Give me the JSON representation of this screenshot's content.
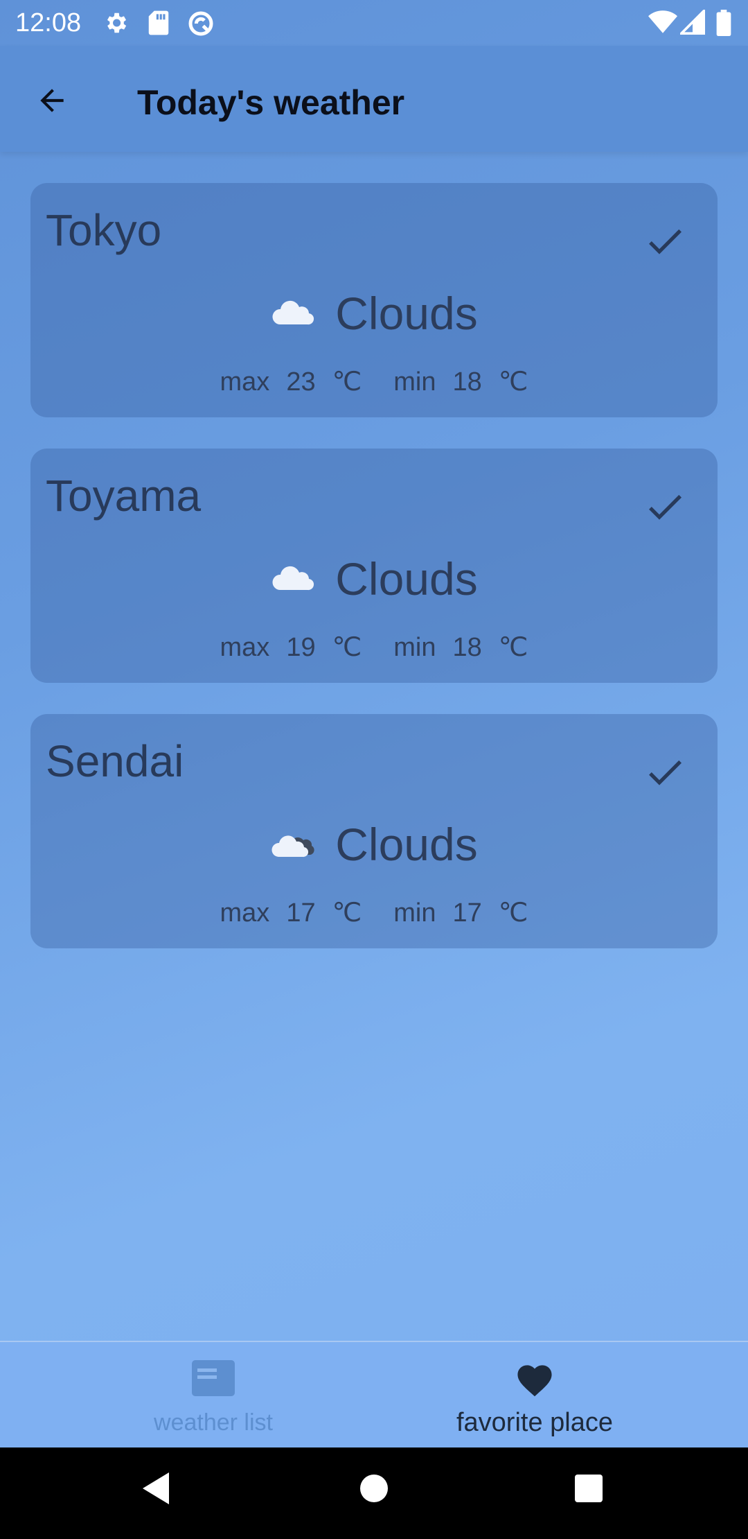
{
  "status_bar": {
    "time": "12:08",
    "icons": [
      "settings-icon",
      "sd-card-icon",
      "sync-icon",
      "wifi-icon",
      "cell-signal-icon",
      "battery-icon"
    ]
  },
  "app_bar": {
    "title": "Today's weather",
    "back_icon": "arrow-back-icon"
  },
  "units": {
    "max": "max",
    "min": "min",
    "deg": "℃"
  },
  "cards": [
    {
      "city": "Tokyo",
      "weather": "Clouds",
      "icon": "cloud-icon",
      "max": "23",
      "min": "18",
      "favorite": true
    },
    {
      "city": "Toyama",
      "weather": "Clouds",
      "icon": "cloud-icon",
      "max": "19",
      "min": "18",
      "favorite": true
    },
    {
      "city": "Sendai",
      "weather": "Clouds",
      "icon": "broken-clouds-icon",
      "max": "17",
      "min": "17",
      "favorite": true
    }
  ],
  "bottom_nav": {
    "items": [
      {
        "label": "weather list",
        "icon": "list-icon",
        "active": false
      },
      {
        "label": "favorite place",
        "icon": "heart-icon",
        "active": true
      }
    ]
  },
  "colors": {
    "background": "#6a9ee2",
    "app_bar": "#5b8fd6",
    "card": "#4a75b8",
    "text_dark": "#283a5a",
    "nav_bar": "#7fb0f2",
    "nav_inactive": "#5d8fd0",
    "nav_active": "#1d2a3c"
  }
}
